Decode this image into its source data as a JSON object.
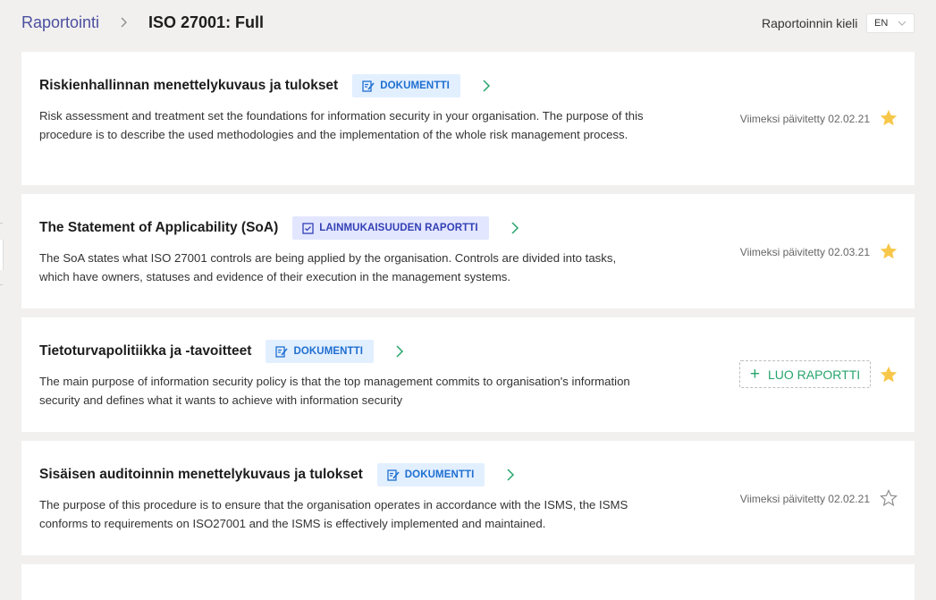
{
  "breadcrumb": {
    "root": "Raportointi",
    "current": "ISO 27001: Full"
  },
  "language": {
    "label": "Raportoinnin kieli",
    "selected": "EN"
  },
  "colors": {
    "accent_green": "#27a56c",
    "star_filled": "#f7c749",
    "doc_badge": "#1f6fd0",
    "compliance_badge": "#3340b5"
  },
  "reports": [
    {
      "title": "Riskienhallinnan menettelykuvaus ja tulokset",
      "badge": "DOKUMENTTI",
      "badge_type": "document",
      "description": "Risk assessment and treatment set the foundations for information security in your organisation. The purpose of this procedure is to describe the used methodologies and the implementation of the whole risk management process.",
      "updated": "Viimeksi päivitetty 02.02.21",
      "starred": true
    },
    {
      "title": "The Statement of Applicability (SoA)",
      "badge": "LAINMUKAISUUDEN RAPORTTI",
      "badge_type": "compliance",
      "description": "The SoA states what ISO 27001 controls are being applied by the organisation. Controls are divided into tasks, which have owners, statuses and evidence of their execution in the management systems.",
      "updated": "Viimeksi päivitetty 02.03.21",
      "starred": true
    },
    {
      "title": "Tietoturvapolitiikka ja -tavoitteet",
      "badge": "DOKUMENTTI",
      "badge_type": "document",
      "description": "The main purpose of information security policy is that the top management commits to organisation's information security and defines what it wants to achieve with information security",
      "create_label": "LUO RAPORTTI",
      "starred": true
    },
    {
      "title": "Sisäisen auditoinnin menettelykuvaus ja tulokset",
      "badge": "DOKUMENTTI",
      "badge_type": "document",
      "description": "The purpose of this procedure is to ensure that the organisation operates in accordance with the ISMS, the ISMS conforms to requirements on ISO27001 and the ISMS is effectively implemented and maintained.",
      "updated": "Viimeksi päivitetty 02.02.21",
      "starred": false
    }
  ]
}
